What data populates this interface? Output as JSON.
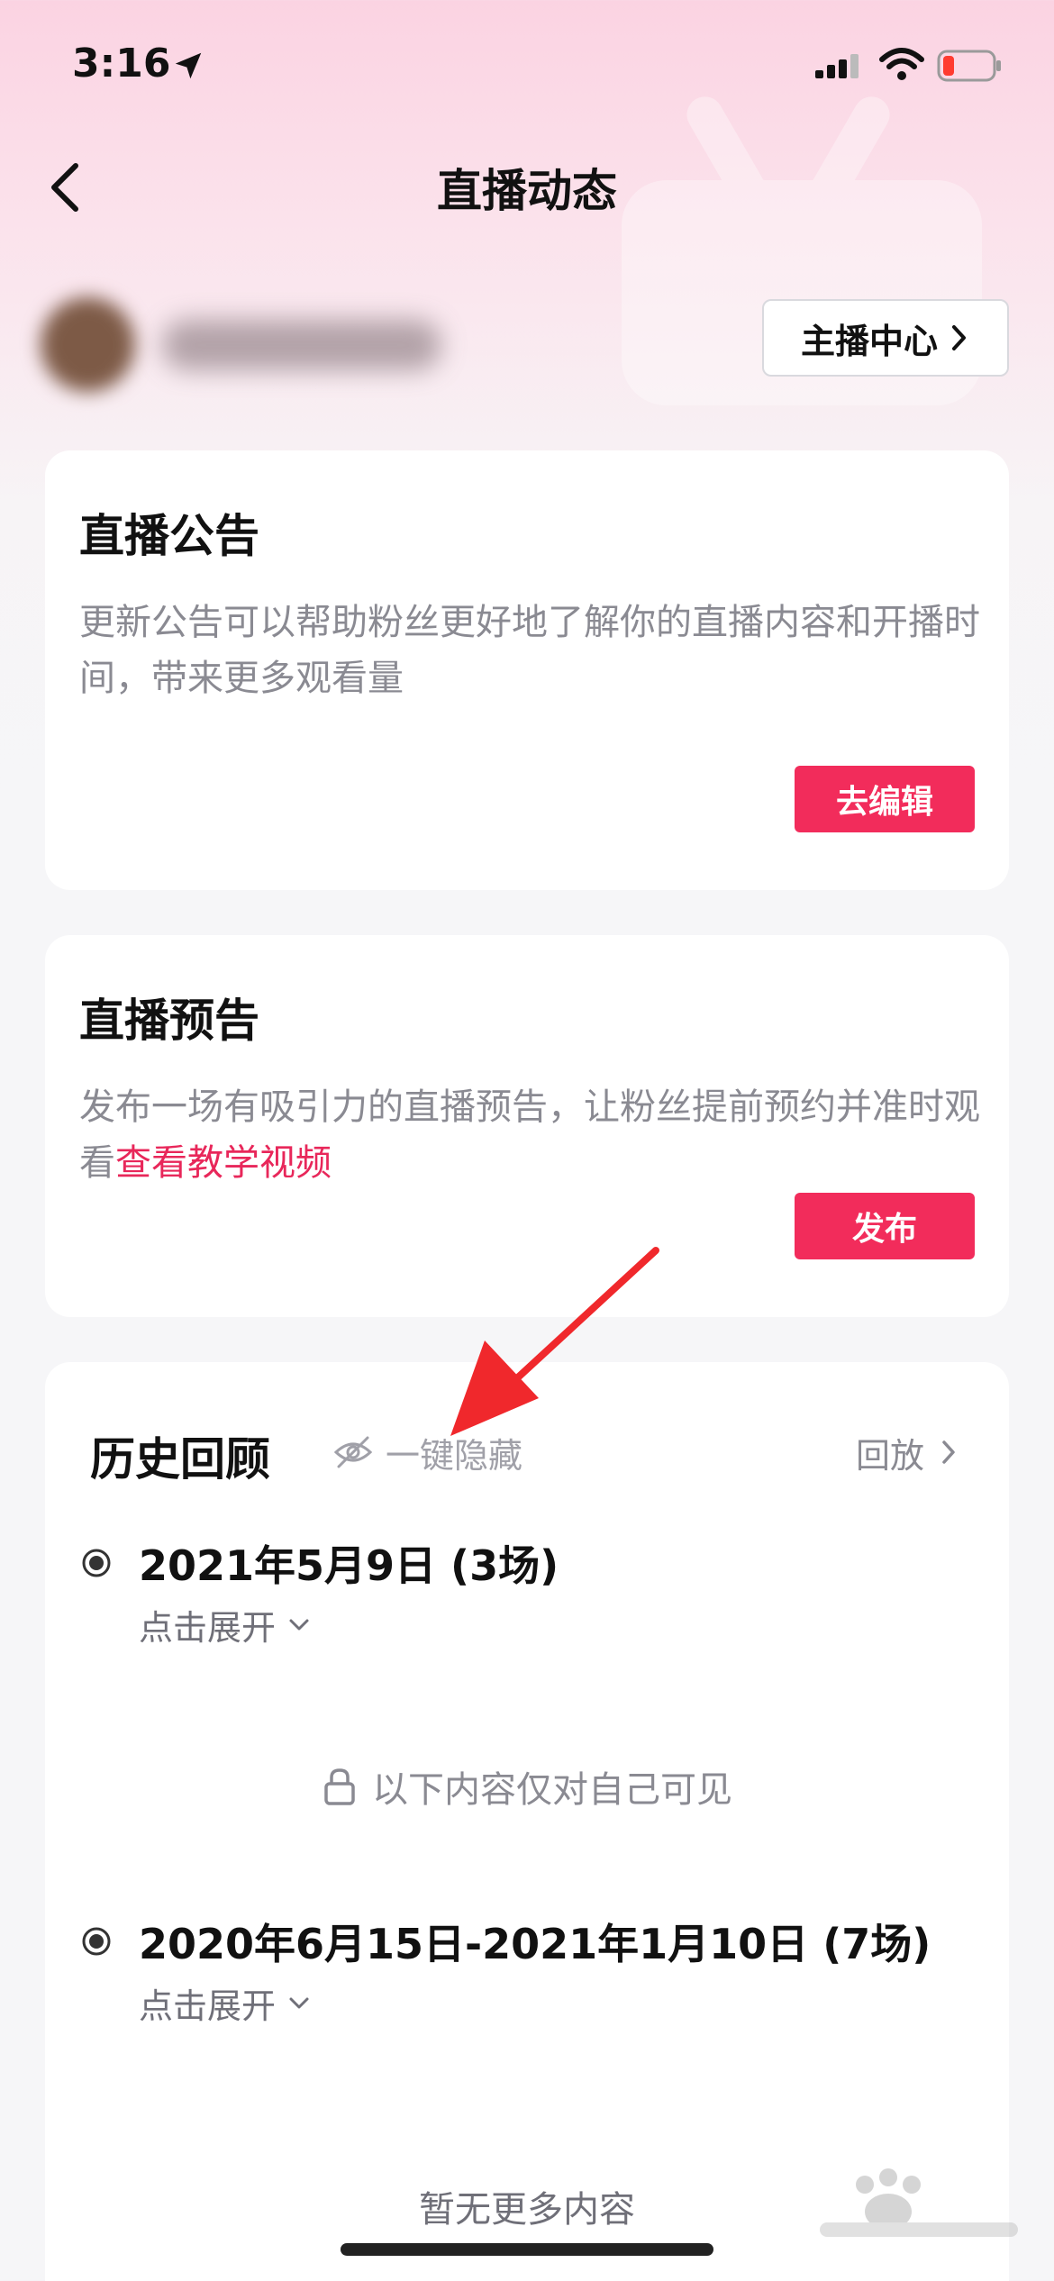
{
  "status_bar": {
    "time": "3:16"
  },
  "nav": {
    "title": "直播动态"
  },
  "profile": {
    "center_button": "主播中心"
  },
  "announcement": {
    "title": "直播公告",
    "description": "更新公告可以帮助粉丝更好地了解你的直播内容和开播时间，带来更多观看量",
    "button": "去编辑"
  },
  "preview": {
    "title": "直播预告",
    "description": "发布一场有吸引力的直播预告，让粉丝提前预约并准时观看",
    "link": "查看教学视频",
    "button": "发布"
  },
  "history": {
    "title": "历史回顾",
    "hide_label": "一键隐藏",
    "replay_label": "回放",
    "sessions": [
      {
        "date": "2021年5月9日 (3场)",
        "expand": "点击展开"
      },
      {
        "date": "2020年6月15日-2021年1月10日 (7场)",
        "expand": "点击展开"
      }
    ],
    "private_note": "以下内容仅对自己可见",
    "no_more": "暂无更多内容"
  },
  "colors": {
    "accent": "#f22c5b",
    "link": "#e8275a",
    "annotation_arrow": "#f0282c"
  },
  "icons": [
    "location-arrow-icon",
    "signal-icon",
    "wifi-icon",
    "battery-icon",
    "back-icon",
    "chevron-right-icon",
    "eye-off-icon",
    "radio-icon",
    "chevron-down-icon",
    "lock-icon"
  ]
}
